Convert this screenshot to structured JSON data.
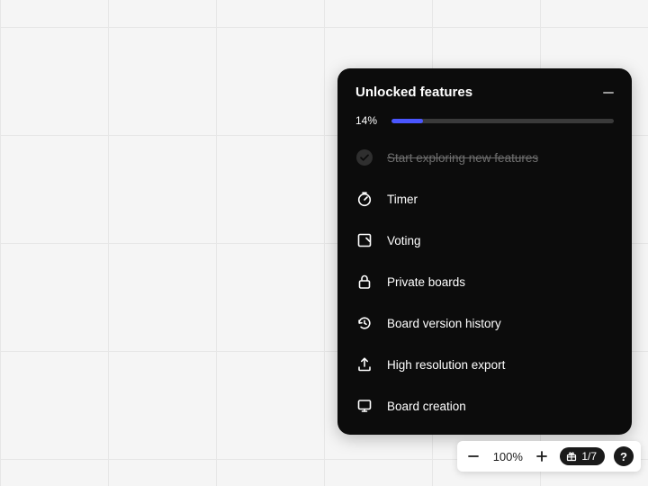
{
  "panel": {
    "title": "Unlocked features",
    "progress": {
      "percent_label": "14%",
      "percent_value": 14
    },
    "features": [
      {
        "label": "Start exploring new features",
        "completed": true
      },
      {
        "label": "Timer"
      },
      {
        "label": "Voting"
      },
      {
        "label": "Private boards"
      },
      {
        "label": "Board version history"
      },
      {
        "label": "High resolution export"
      },
      {
        "label": "Board creation"
      }
    ]
  },
  "zoombar": {
    "level": "100%",
    "counter": "1/7"
  }
}
